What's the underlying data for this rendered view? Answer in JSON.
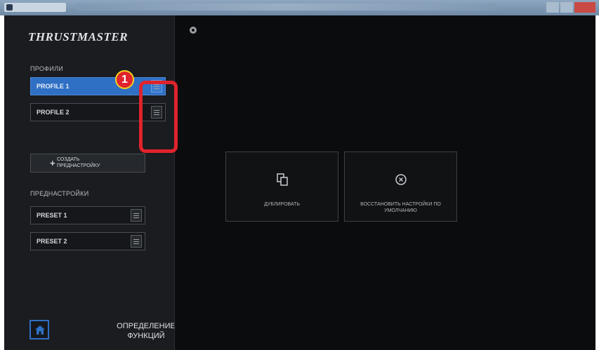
{
  "window": {
    "title_placeholder": "",
    "controls": [
      "minimize",
      "maximize",
      "close"
    ]
  },
  "app": {
    "logo": "THRUSTMASTER"
  },
  "profiles": {
    "heading": "ПРОФИЛИ",
    "items": [
      {
        "label": "PROFILE 1",
        "selected": true
      },
      {
        "label": "PROFILE 2",
        "selected": false
      }
    ]
  },
  "create_preset": {
    "label_line1": "СОЗДАТЬ",
    "label_line2": "ПРЕДНАСТРОЙКУ",
    "icon": "plus-icon"
  },
  "presets": {
    "heading": "ПРЕДНАСТРОЙКИ",
    "items": [
      {
        "label": "PRESET 1"
      },
      {
        "label": "PRESET 2"
      }
    ]
  },
  "footer": {
    "home_icon": "home-icon",
    "function_label_line1": "ОПРЕДЕЛЕНИЕ",
    "function_label_line2": "ФУНКЦИЙ"
  },
  "actions": [
    {
      "label": "ДУБЛИРОВАТЬ",
      "icon": "duplicate-icon"
    },
    {
      "label": "ВОССТАНОВИТЬ НАСТРОЙКИ ПО УМОЛЧАНИЮ",
      "icon": "restore-icon"
    }
  ],
  "annotation": {
    "number": "1",
    "color": "#e0232c"
  },
  "colors": {
    "accent": "#2f6fc4",
    "background": "#0b0c0e",
    "sidebar": "#1a1c1f"
  }
}
